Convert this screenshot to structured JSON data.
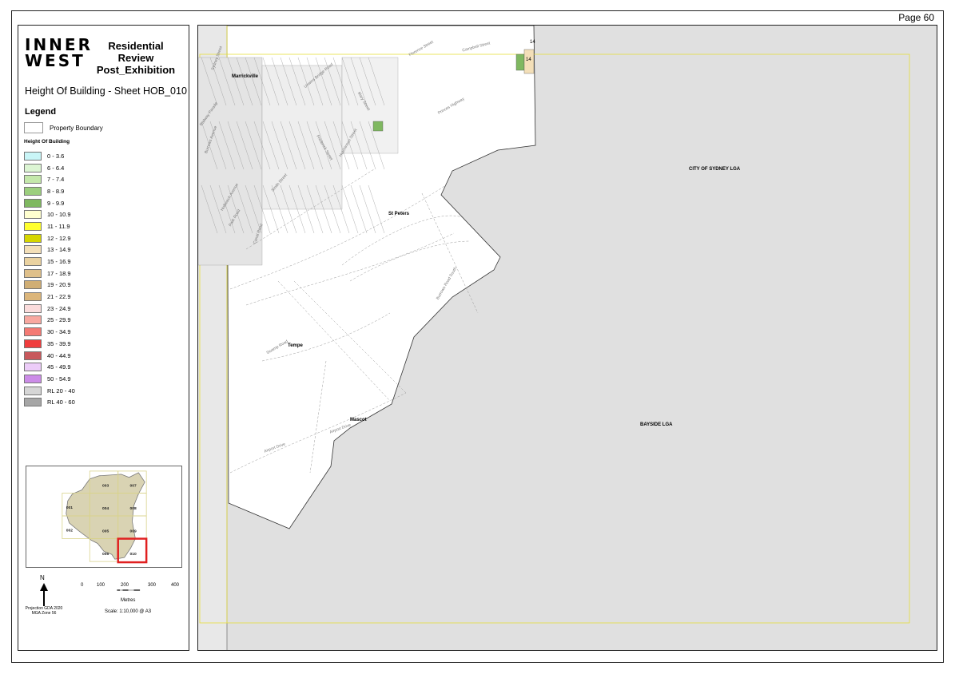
{
  "page": {
    "number_label": "Page 60"
  },
  "logo": {
    "line1": "INNER",
    "line2": "WEST"
  },
  "title": {
    "line1": "Residential",
    "line2": "Review",
    "line3": "Post_Exhibition"
  },
  "sheet_title": "Height Of Building - Sheet HOB_010",
  "legend": {
    "heading": "Legend",
    "property_boundary": "Property Boundary",
    "hob_heading": "Height Of Building",
    "items": [
      {
        "label": "0 - 3.6",
        "color": "#c9f5f7"
      },
      {
        "label": "6 - 6.4",
        "color": "#dcf5d3"
      },
      {
        "label": "7 - 7.4",
        "color": "#c4e8ab"
      },
      {
        "label": "8 - 8.9",
        "color": "#9ccf7e"
      },
      {
        "label": "9 - 9.9",
        "color": "#7fb860"
      },
      {
        "label": "10 - 10.9",
        "color": "#ffffcf"
      },
      {
        "label": "11 - 11.9",
        "color": "#ffff2e"
      },
      {
        "label": "12 - 12.9",
        "color": "#d6d600"
      },
      {
        "label": "13 - 14.9",
        "color": "#f3dfb8"
      },
      {
        "label": "15 - 16.9",
        "color": "#ead2a0"
      },
      {
        "label": "17 - 18.9",
        "color": "#dfc08a"
      },
      {
        "label": "19 - 20.9",
        "color": "#d0ae74"
      },
      {
        "label": "21 - 22.9",
        "color": "#dcb67b"
      },
      {
        "label": "23 - 24.9",
        "color": "#fbdcdc"
      },
      {
        "label": "25 - 29.9",
        "color": "#f8a8a0"
      },
      {
        "label": "30 - 34.9",
        "color": "#f47a74"
      },
      {
        "label": "35 - 39.9",
        "color": "#f03c3c"
      },
      {
        "label": "40 - 44.9",
        "color": "#c8585c"
      },
      {
        "label": "45 - 49.9",
        "color": "#ecccf8"
      },
      {
        "label": "50 - 54.9",
        "color": "#cc8ce8"
      },
      {
        "label": "RL 20 - 40",
        "color": "#d6d6d6"
      },
      {
        "label": "RL 40 - 60",
        "color": "#a6a6a6"
      }
    ]
  },
  "keymap": {
    "sheets": [
      "001",
      "002",
      "003",
      "004",
      "005",
      "006",
      "007",
      "008",
      "009",
      "010"
    ],
    "highlighted": "010"
  },
  "north": {
    "label": "N"
  },
  "scale": {
    "ticks": [
      "0",
      "100",
      "200",
      "300",
      "400"
    ],
    "units": "Metres",
    "text": "Scale: 1:10,000 @ A3"
  },
  "projection": {
    "line1": "Projection GDA 2020",
    "line2": "MGA Zone 56"
  },
  "map": {
    "places": [
      "Marrickville",
      "St Peters",
      "Tempe",
      "Mascot"
    ],
    "lgas": [
      "CITY OF SYDNEY LGA",
      "BAYSIDE LGA"
    ],
    "streets": [
      "Unwins Bridge Road",
      "Princes Highway",
      "Railway Parade",
      "Burrows Avenue",
      "Sydney Street",
      "Florence Street",
      "Mary Street",
      "Canal Road",
      "Burrows Road South",
      "Swamp Road",
      "Airport Drive",
      "Hutchinson Street",
      "Smith Street",
      "Campbell Street",
      "Park Road",
      "Holbeach Avenue",
      "Frederick Street"
    ],
    "hob_labels": [
      "14",
      "14"
    ]
  },
  "colors": {
    "out_of_area": "#e0e0e0",
    "land": "#ffffff",
    "frame_line": "#e6de3a",
    "highlight": "#e02020",
    "hob_green": "#7fb860"
  }
}
